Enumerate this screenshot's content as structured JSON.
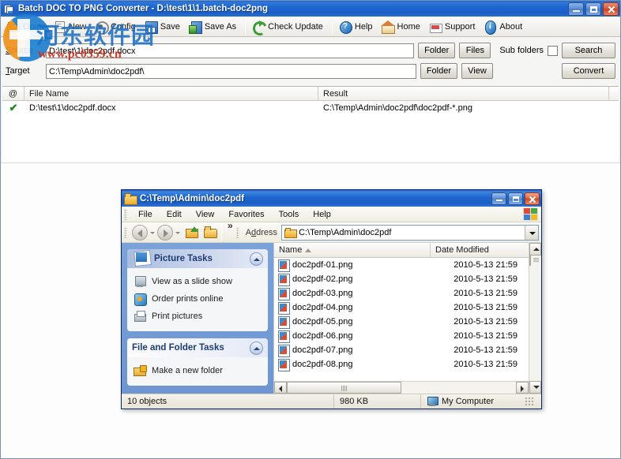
{
  "app": {
    "title": "Batch DOC TO PNG Converter - D:\\test\\1\\1.batch-doc2png",
    "toolbar": [
      {
        "label": "Open",
        "icon": "open-folder-icon"
      },
      {
        "label": "New",
        "icon": "new-document-icon"
      },
      {
        "label": "Config",
        "icon": "config-gear-icon"
      },
      {
        "label": "Save",
        "icon": "save-floppy-icon"
      },
      {
        "label": "Save As",
        "icon": "save-as-floppy-icon"
      },
      {
        "label": "Check Update",
        "icon": "refresh-update-icon"
      },
      {
        "label": "Help",
        "icon": "help-question-icon"
      },
      {
        "label": "Home",
        "icon": "home-house-icon"
      },
      {
        "label": "Support",
        "icon": "support-mail-icon"
      },
      {
        "label": "About",
        "icon": "about-info-icon"
      }
    ],
    "source": {
      "label": "Source",
      "value": "D:\\test\\1\\doc2pdf.docx",
      "folder_button": "Folder",
      "files_button": "Files",
      "subfolders_label": "Sub folders",
      "subfolders_checked": false,
      "search_button": "Search"
    },
    "target": {
      "label": "Target",
      "value": "C:\\Temp\\Admin\\doc2pdf\\",
      "folder_button": "Folder",
      "view_button": "View",
      "convert_button": "Convert"
    },
    "list": {
      "columns": [
        "@",
        "File Name",
        "Result",
        ""
      ],
      "rows": [
        {
          "status": "✔",
          "file_name": "D:\\test\\1\\doc2pdf.docx",
          "result": "C:\\Temp\\Admin\\doc2pdf\\doc2pdf-*.png"
        }
      ]
    }
  },
  "watermark": {
    "site_name": "河东软件园",
    "url": "www.pc0359.cn"
  },
  "explorer": {
    "title": "C:\\Temp\\Admin\\doc2pdf",
    "menus": [
      "File",
      "Edit",
      "View",
      "Favorites",
      "Tools",
      "Help"
    ],
    "toolbar": {
      "back": "Back",
      "forward": "Forward",
      "up": "Up",
      "folders": "Folders",
      "overflow": "»"
    },
    "address": {
      "label": "Address",
      "value": "C:\\Temp\\Admin\\doc2pdf"
    },
    "task_panes": [
      {
        "title": "Picture Tasks",
        "items": [
          {
            "label": "View as a slide show",
            "icon": "slideshow-icon"
          },
          {
            "label": "Order prints online",
            "icon": "order-prints-icon"
          },
          {
            "label": "Print pictures",
            "icon": "print-icon"
          }
        ]
      },
      {
        "title": "File and Folder Tasks",
        "items": [
          {
            "label": "Make a new folder",
            "icon": "new-folder-icon"
          }
        ]
      }
    ],
    "file_list": {
      "columns": [
        "Name",
        "Date Modified"
      ],
      "sort_column": "Name",
      "sort_direction": "ascending",
      "rows": [
        {
          "name": "doc2pdf-01.png",
          "date_modified": "2010-5-13 21:59"
        },
        {
          "name": "doc2pdf-02.png",
          "date_modified": "2010-5-13 21:59"
        },
        {
          "name": "doc2pdf-03.png",
          "date_modified": "2010-5-13 21:59"
        },
        {
          "name": "doc2pdf-04.png",
          "date_modified": "2010-5-13 21:59"
        },
        {
          "name": "doc2pdf-05.png",
          "date_modified": "2010-5-13 21:59"
        },
        {
          "name": "doc2pdf-06.png",
          "date_modified": "2010-5-13 21:59"
        },
        {
          "name": "doc2pdf-07.png",
          "date_modified": "2010-5-13 21:59"
        },
        {
          "name": "doc2pdf-08.png",
          "date_modified": "2010-5-13 21:59"
        }
      ]
    },
    "status": {
      "objects": "10 objects",
      "size": "980 KB",
      "location": "My Computer"
    }
  },
  "colors": {
    "titlebar_blue": "#1d66cf",
    "watermark_blue": "#1f6fc4",
    "watermark_red": "#d02a16",
    "check_green": "#1a8a1a",
    "taskpane_blue": "#7ba2d9"
  }
}
